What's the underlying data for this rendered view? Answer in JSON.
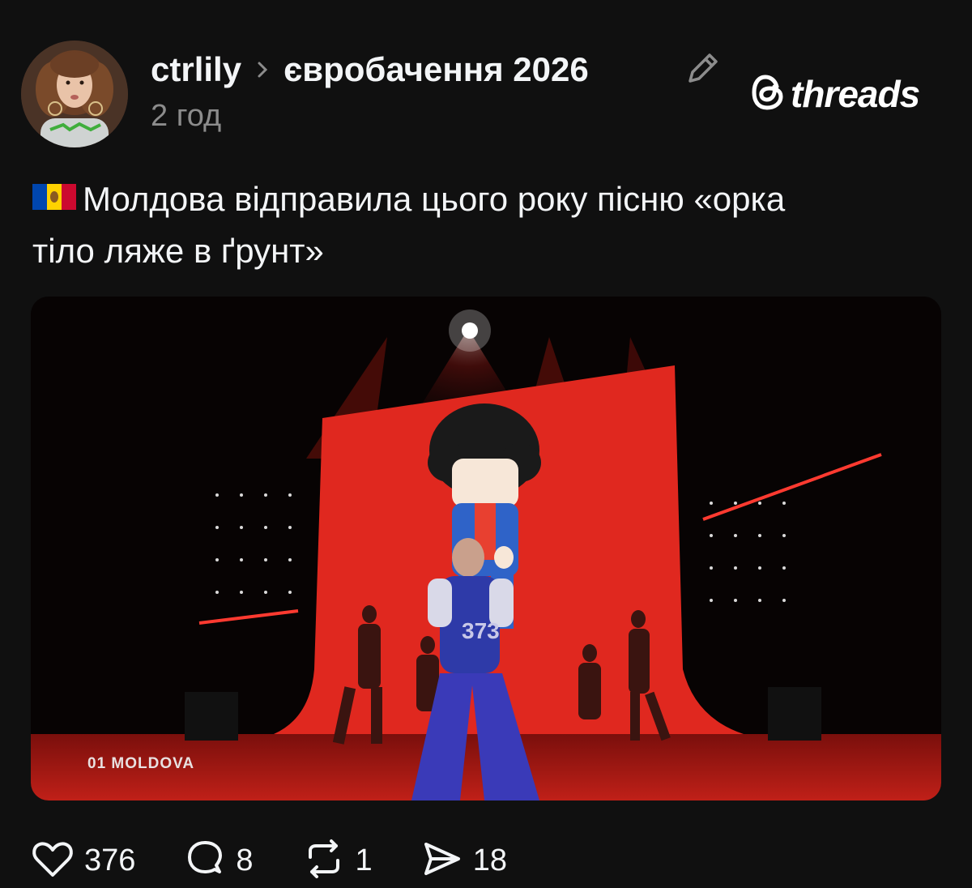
{
  "post": {
    "username": "ctrlily",
    "topic": "євробачення 2026",
    "time": "2 год",
    "text_line1": "Молдова відправила цього року пісню «орка",
    "text_line2": "тіло ляже в ґрунт»"
  },
  "brand": {
    "name": "threads"
  },
  "media": {
    "overlay_caption": "01 MOLDOVA",
    "shirt_text": "373"
  },
  "actions": {
    "likes": "376",
    "replies": "8",
    "reposts": "1",
    "shares": "18"
  },
  "icons": [
    "avatar",
    "chevron-right-icon",
    "pencil-icon",
    "threads-logo-icon",
    "moldova-flag-icon",
    "heart-icon",
    "comment-icon",
    "repost-icon",
    "share-icon"
  ],
  "colors": {
    "background": "#101010",
    "text": "#f3f5f7",
    "muted": "#8c8c8c",
    "stage_red": "#e0281f"
  }
}
